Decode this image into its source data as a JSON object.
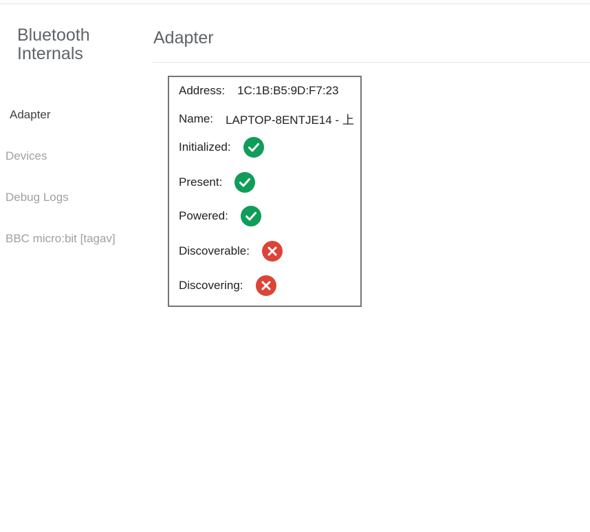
{
  "sidebar": {
    "title": "Bluetooth Internals",
    "items": [
      {
        "label": "Adapter",
        "selected": true
      },
      {
        "label": "Devices",
        "selected": false
      },
      {
        "label": "Debug Logs",
        "selected": false
      },
      {
        "label": "BBC micro:bit [tagav]",
        "selected": false
      }
    ]
  },
  "main": {
    "title": "Adapter"
  },
  "adapter": {
    "address_label": "Address:",
    "address_value": "1C:1B:B5:9D:F7:23",
    "name_label": "Name:",
    "name_value": "LAPTOP-8ENTJE14 - 上",
    "initialized_label": "Initialized:",
    "initialized": true,
    "present_label": "Present:",
    "present": true,
    "powered_label": "Powered:",
    "powered": true,
    "discoverable_label": "Discoverable:",
    "discoverable": false,
    "discovering_label": "Discovering:",
    "discovering": false
  },
  "colors": {
    "success": "#0f9d58",
    "error": "#db4437"
  },
  "icons": {
    "success": "check-circle-icon",
    "error": "x-circle-icon"
  }
}
